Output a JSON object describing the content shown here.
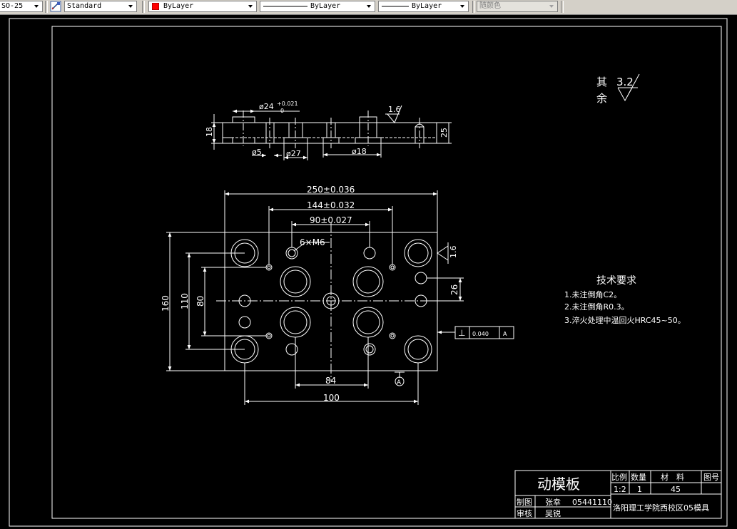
{
  "toolbar": {
    "dimstyle": "SO-25",
    "textstyle": "Standard",
    "layer_color": "ByLayer",
    "linetype": "ByLayer",
    "lineweight": "ByLayer",
    "plotstyle": "随颜色",
    "layer_swatch_color": "#ff0000",
    "icons": {
      "dimstyle_button": "dimension-style-icon",
      "dropdown": "chevron-down-icon"
    }
  },
  "drawing": {
    "roughness_other_label_1": "其",
    "roughness_other_label_2": "余",
    "roughness_other_value": "3.2",
    "side_view": {
      "dia24_main": "ø24",
      "dia24_tol_upper": "+0.021",
      "dia24_tol_lower": "0",
      "roughness": "1.6",
      "height_left": "18",
      "height_right": "25",
      "dia5": "ø5",
      "dia27": "ø27",
      "dia18": "ø18"
    },
    "plan_view": {
      "dim_250": "250±0.036",
      "dim_144": "144±0.032",
      "dim_90": "90±0.027",
      "thread": "6×M6",
      "roughness_right": "1.6",
      "dim_26": "26",
      "dim_160": "160",
      "dim_110": "110",
      "dim_80": "80",
      "dim_84": "84",
      "dim_100": "100",
      "perp_symbol": "⊥",
      "perp_tolerance": "0.040",
      "perp_datum": "A",
      "datum_label": "A"
    },
    "tech_requirements": {
      "title": "技术要求",
      "items": [
        "1.未注倒角C2。",
        "2.未注倒角R0.3。",
        "3.淬火处理中温回火HRC45~50。"
      ]
    },
    "title_block": {
      "part_name": "动模板",
      "scale_label": "比例",
      "quantity_label": "数量",
      "material_label": "材　料",
      "drawing_no_label": "图号",
      "scale_value": "1:2",
      "quantity_value": "1",
      "material_value": "45",
      "drawn_label": "制图",
      "drawn_name": "张幸",
      "drawn_id": "05441110",
      "checked_label": "审核",
      "checked_name": "吴锐",
      "school": "洛阳理工学院西校区05模具"
    }
  }
}
